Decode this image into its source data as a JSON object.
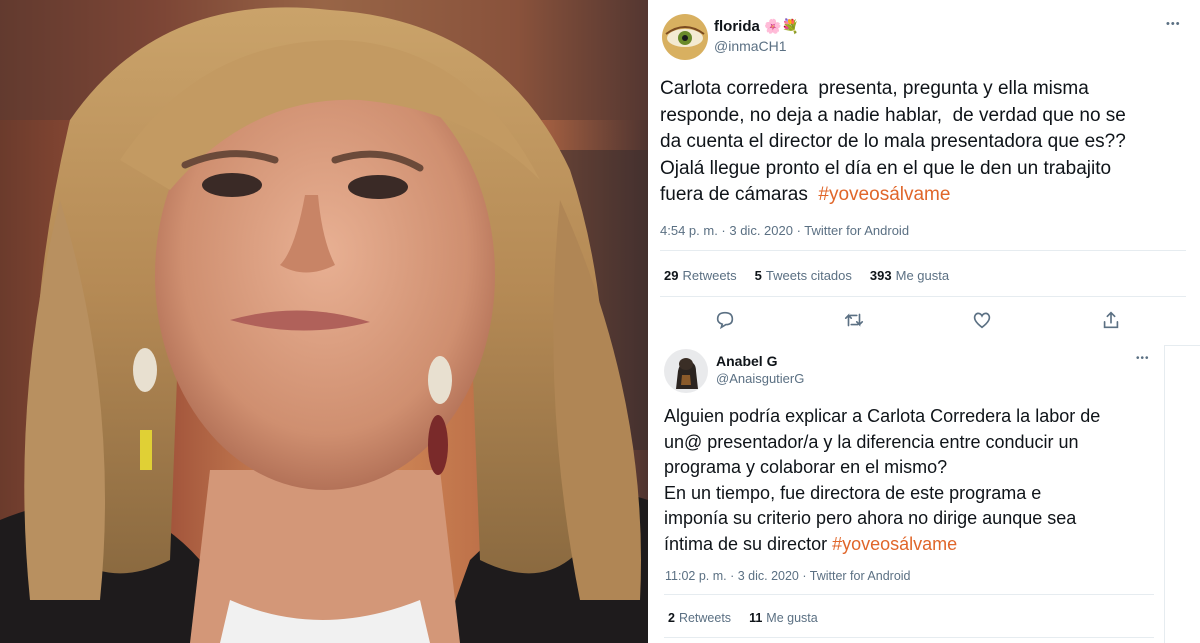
{
  "tweet1": {
    "name": "florida",
    "name_emojis": "🌸💐",
    "handle": "@inmaCH1",
    "more": "•••",
    "text_main": "Carlota corredera  presenta, pregunta y ella misma\nresponde, no deja a nadie hablar,  de verdad que no se\nda cuenta el director de lo mala presentadora que es??\nOjalá llegue pronto el día en el que le den un trabajito\nfuera de cámaras  ",
    "hashtag": "#yoveosálvame",
    "timestamp": "4:54 p. m. · 3 dic. 2020 · Twitter for Android",
    "stats": {
      "retweets_count": "29",
      "retweets_label": "Retweets",
      "quotes_count": "5",
      "quotes_label": "Tweets citados",
      "likes_count": "393",
      "likes_label": "Me gusta"
    },
    "actions": [
      "reply-icon",
      "retweet-icon",
      "like-icon",
      "share-icon"
    ]
  },
  "tweet2": {
    "name": "Anabel G",
    "handle": "@AnaisgutierG",
    "more": "•••",
    "text_main": "Alguien podría explicar a Carlota Corredera la labor de\nun@ presentador/a y la diferencia entre conducir un\nprograma y colaborar en el mismo?\nEn un tiempo, fue directora de este programa e\nimponía su criterio pero ahora no dirige aunque sea\níntima de su director ",
    "hashtag": "#yoveosálvame",
    "timestamp": "11:02 p. m. · 3 dic. 2020 · Twitter for Android",
    "stats": {
      "retweets_count": "2",
      "retweets_label": "Retweets",
      "likes_count": "11",
      "likes_label": "Me gusta"
    }
  },
  "colors": {
    "hashtag": "#e0662a",
    "secondary_text": "#5b7083",
    "divider": "#e6ecf0"
  }
}
